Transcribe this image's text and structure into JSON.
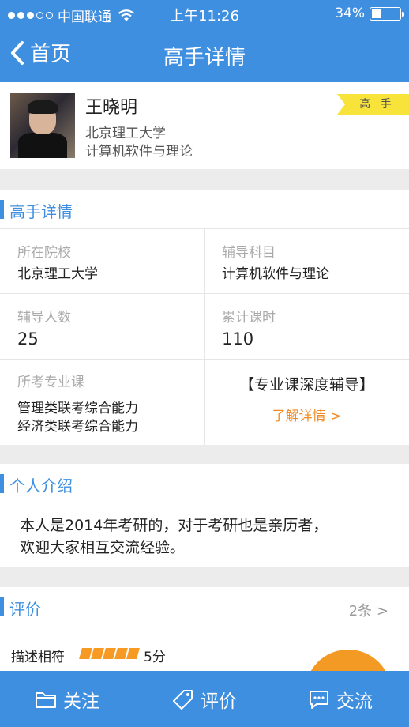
{
  "status": {
    "carrier": "中国联通",
    "time": "上午11:26",
    "battery": "34%"
  },
  "nav": {
    "back_label": "首页",
    "title": "高手详情"
  },
  "profile": {
    "name": "王晓明",
    "university": "北京理工大学",
    "major": "计算机软件与理论",
    "badge": "高 手"
  },
  "details": {
    "section_title": "高手详情",
    "school_label": "所在院校",
    "school_value": "北京理工大学",
    "subject_label": "辅导科目",
    "subject_value": "计算机软件与理论",
    "students_label": "辅导人数",
    "students_value": "25",
    "hours_label": "累计课时",
    "hours_value": "110",
    "courses_label": "所考专业课",
    "courses": [
      "管理类联考综合能力",
      "经济类联考综合能力"
    ],
    "promo_title": "【专业课深度辅导】",
    "promo_link": "了解详情 >"
  },
  "intro": {
    "section_title": "个人介绍",
    "text_line1": "本人是2014年考研的，对于考研也是亲历者，",
    "text_line2": "欢迎大家相互交流经验。"
  },
  "reviews": {
    "section_title": "评价",
    "count": "2条 >",
    "rating_label": "描述相符",
    "rating_value": "5分",
    "rating_stars": 5
  },
  "tabbar": {
    "follow": "关注",
    "review": "评价",
    "chat": "交流"
  },
  "colors": {
    "primary": "#3f8fe0",
    "accent": "#f08a22",
    "badge": "#f7e33a"
  }
}
